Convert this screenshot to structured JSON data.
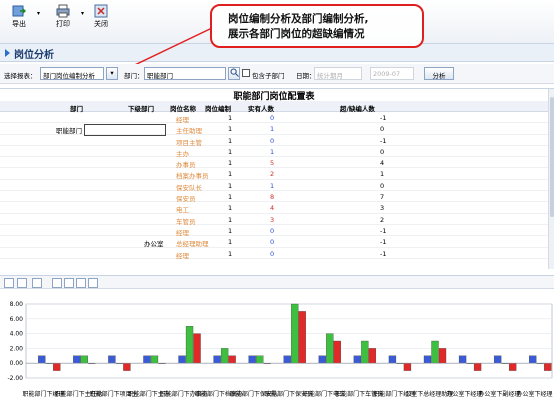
{
  "toolbar": {
    "buttons": [
      {
        "label": "导出",
        "icon": "export-icon"
      },
      {
        "label": "打印",
        "icon": "print-icon"
      },
      {
        "label": "关闭",
        "icon": "close-icon"
      }
    ]
  },
  "page_title": "岗位分析",
  "callout": {
    "line1": "岗位编制分析及部门编制分析,",
    "line2": "展示各部门岗位的超缺编情况"
  },
  "filter": {
    "scheme_label": "选择报表：",
    "scheme_value": "部门岗位编制分析",
    "dept_label": "部门：",
    "dept_value": "职能部门",
    "include_sub_label": "包含子部门",
    "date_label": "日期：",
    "date_mode": "统计期月",
    "date_value": "2009-07",
    "analyze_label": "分析"
  },
  "grid": {
    "title": "职能部门岗位配置表",
    "headers": [
      "部门",
      "下级部门",
      "岗位名称",
      "岗位编制",
      "实有人数",
      "超/缺编人数"
    ],
    "rows": [
      {
        "dept": "",
        "sub": "",
        "pos": "经理",
        "quota": "1",
        "actual": "0",
        "actual_color": "blue",
        "diff": "-1"
      },
      {
        "dept": "职能部门",
        "sub": "",
        "pos": "主任助理",
        "quota": "1",
        "actual": "1",
        "actual_color": "blue",
        "diff": "0"
      },
      {
        "dept": "",
        "sub": "",
        "pos": "项目主管",
        "quota": "1",
        "actual": "0",
        "actual_color": "blue",
        "diff": "-1"
      },
      {
        "dept": "",
        "sub": "",
        "pos": "主办",
        "quota": "1",
        "actual": "1",
        "actual_color": "blue",
        "diff": "0"
      },
      {
        "dept": "",
        "sub": "",
        "pos": "办事员",
        "quota": "1",
        "actual": "5",
        "actual_color": "red",
        "diff": "4"
      },
      {
        "dept": "",
        "sub": "",
        "pos": "档案办事员",
        "quota": "1",
        "actual": "2",
        "actual_color": "red",
        "diff": "1"
      },
      {
        "dept": "",
        "sub": "",
        "pos": "保安队长",
        "quota": "1",
        "actual": "1",
        "actual_color": "blue",
        "diff": "0"
      },
      {
        "dept": "",
        "sub": "",
        "pos": "保安员",
        "quota": "1",
        "actual": "8",
        "actual_color": "red",
        "diff": "7"
      },
      {
        "dept": "",
        "sub": "",
        "pos": "电工",
        "quota": "1",
        "actual": "4",
        "actual_color": "red",
        "diff": "3"
      },
      {
        "dept": "",
        "sub": "",
        "pos": "车管员",
        "quota": "1",
        "actual": "3",
        "actual_color": "red",
        "diff": "2"
      },
      {
        "dept": "",
        "sub": "",
        "pos": "经理",
        "quota": "1",
        "actual": "0",
        "actual_color": "blue",
        "diff": "-1"
      },
      {
        "dept": "",
        "sub": "办公室",
        "pos": "总经理助理",
        "quota": "1",
        "actual": "0",
        "actual_color": "blue",
        "diff": "-1"
      },
      {
        "dept": "",
        "sub": "",
        "pos": "经理",
        "quota": "1",
        "actual": "0",
        "actual_color": "blue",
        "diff": "-1"
      }
    ]
  },
  "chart_toolbar": {
    "icons": [
      "copy-icon",
      "print-chart-icon",
      "chart-type-icon",
      "legend-icon",
      "series-icon",
      "grid-icon",
      "table-icon"
    ]
  },
  "chart_data": {
    "type": "bar",
    "categories": [
      "职能部门下经理",
      "职能部门下主任助理",
      "职能部门下项目主管",
      "职能部门下主办",
      "职能部门下办事员",
      "职能部门下档案办事员",
      "职能部门下保安队长",
      "职能部门下保安员",
      "职能部门下电工",
      "职能部门下车管员",
      "职能部门下经理",
      "职能部门下办公室下总经理助理",
      "职能部门下办公室下经理",
      "职能部门下副经理",
      "职能部门下经理"
    ],
    "xtick_labels": [
      "职能部门下经理",
      "职能部门下主任助",
      "职能部门下项目主",
      "职能部门下主办",
      "职能部门下办事员",
      "职能部门下档案办",
      "职能部门下保安队",
      "职能部门下保安员",
      "职能部门下电工",
      "职能部门下车管员",
      "职能部门下经理",
      "公室下总经理助理",
      "办公室下经理",
      "办公室下副经理",
      "办公室下经理"
    ],
    "series": [
      {
        "color": "#3b5bd6",
        "values": [
          1,
          1,
          1,
          1,
          1,
          1,
          1,
          1,
          1,
          1,
          1,
          1,
          1,
          1,
          1
        ]
      },
      {
        "color": "#3fbf3f",
        "values": [
          0,
          1,
          0,
          1,
          5,
          2,
          1,
          8,
          4,
          3,
          0,
          3,
          0,
          0,
          0
        ]
      },
      {
        "color": "#e02a2a",
        "values": [
          -1,
          0,
          -1,
          0,
          4,
          1,
          0,
          7,
          3,
          2,
          -1,
          2,
          -1,
          -1,
          -1
        ]
      }
    ],
    "yticks": [
      "8.00",
      "6.00",
      "4.00",
      "2.00",
      "0.00",
      "-2.00"
    ],
    "ylim": [
      -2,
      8
    ],
    "grid": true
  }
}
